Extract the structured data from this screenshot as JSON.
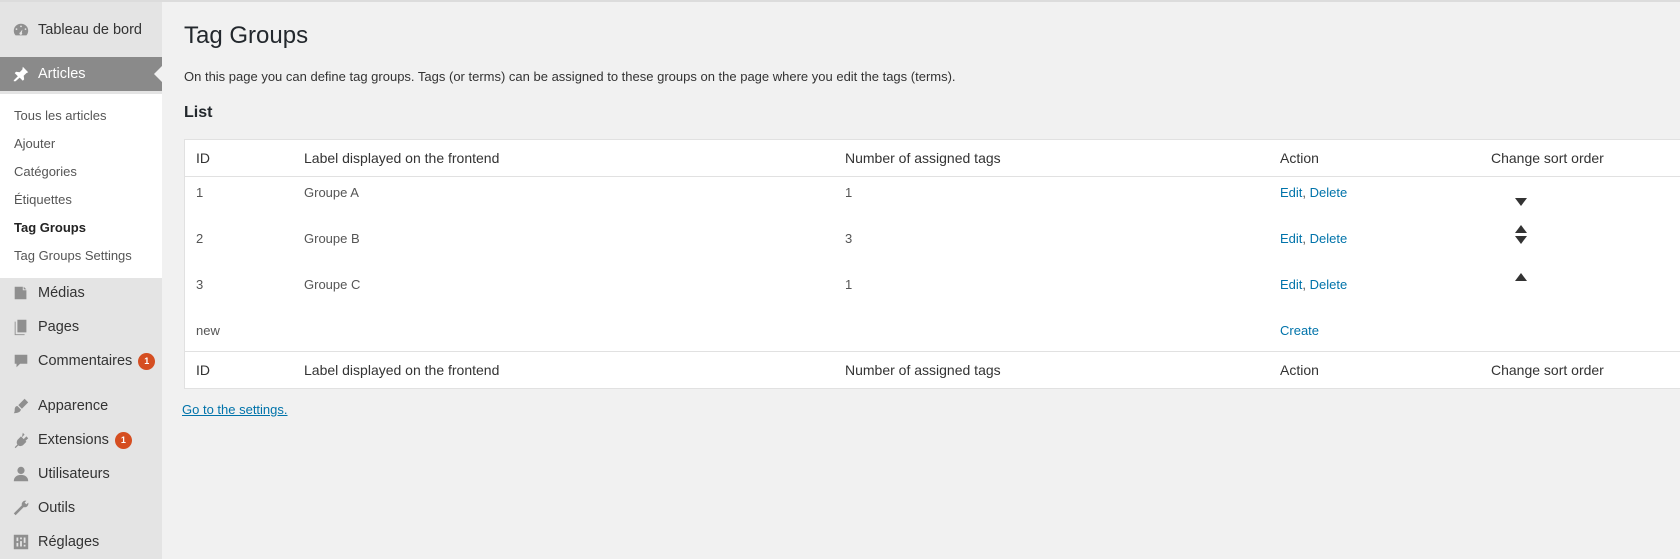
{
  "sidebar": {
    "items": [
      {
        "label": "Tableau de bord",
        "icon": "dashboard-icon"
      },
      {
        "label": "Articles",
        "icon": "pin-icon",
        "current": true
      },
      {
        "label": "Médias",
        "icon": "media-icon"
      },
      {
        "label": "Pages",
        "icon": "pages-icon"
      },
      {
        "label": "Commentaires",
        "icon": "comment-icon",
        "badge": "1"
      },
      {
        "label": "Apparence",
        "icon": "brush-icon"
      },
      {
        "label": "Extensions",
        "icon": "plugin-icon",
        "badge": "1"
      },
      {
        "label": "Utilisateurs",
        "icon": "user-icon"
      },
      {
        "label": "Outils",
        "icon": "wrench-icon"
      },
      {
        "label": "Réglages",
        "icon": "settings-icon"
      }
    ],
    "submenu": [
      {
        "label": "Tous les articles"
      },
      {
        "label": "Ajouter"
      },
      {
        "label": "Catégories"
      },
      {
        "label": "Étiquettes"
      },
      {
        "label": "Tag Groups",
        "current": true
      },
      {
        "label": "Tag Groups Settings"
      }
    ]
  },
  "page": {
    "title": "Tag Groups",
    "intro": "On this page you can define tag groups. Tags (or terms) can be assigned to these groups on the page where you edit the tags (terms).",
    "section_title": "List",
    "settings_link": "Go to the settings."
  },
  "table": {
    "headers": [
      "ID",
      "Label displayed on the frontend",
      "Number of assigned tags",
      "Action",
      "Change sort order"
    ],
    "rows": [
      {
        "id": "1",
        "label": "Groupe A",
        "count": "1",
        "edit": "Edit",
        "sep": ",",
        "delete": "Delete"
      },
      {
        "id": "2",
        "label": "Groupe B",
        "count": "3",
        "edit": "Edit",
        "sep": ",",
        "delete": "Delete"
      },
      {
        "id": "3",
        "label": "Groupe C",
        "count": "1",
        "edit": "Edit",
        "sep": ",",
        "delete": "Delete"
      }
    ],
    "new_row": {
      "id": "new",
      "action": "Create"
    }
  },
  "colors": {
    "link": "#0073aa",
    "badge": "#d54e21",
    "menu_current_bg": "#8a8a8a",
    "sidebar_bg": "#e4e4e4"
  }
}
